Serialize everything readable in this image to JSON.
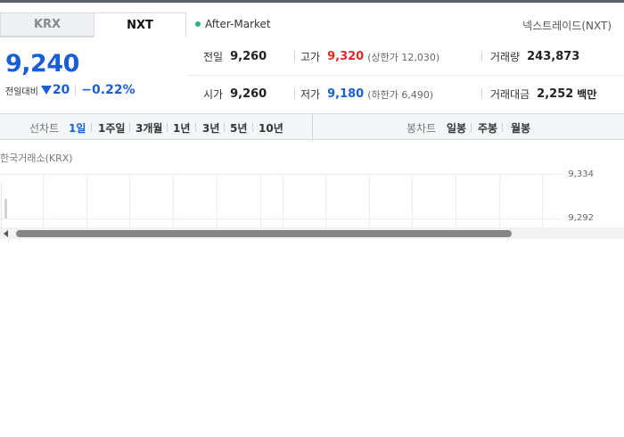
{
  "tabs": [
    {
      "label": "KRX",
      "selected": false
    },
    {
      "label": "NXT",
      "selected": true
    }
  ],
  "session": {
    "label": "After-Market",
    "dot_color": "#2ab27b"
  },
  "exchange_name": "넥스트레이드(NXT)",
  "price": {
    "current": "9,240",
    "change_label": "전일대비",
    "change_value": "20",
    "change_direction": "down",
    "change_percent": "−0.22%"
  },
  "stats": {
    "prev_close": {
      "label": "전일",
      "value": "9,260"
    },
    "high": {
      "label": "고가",
      "value": "9,320",
      "sub": "(상한가 12,030)"
    },
    "volume": {
      "label": "거래량",
      "value": "243,873"
    },
    "open": {
      "label": "시가",
      "value": "9,260"
    },
    "low": {
      "label": "저가",
      "value": "9,180",
      "sub": "(하한가 6,490)"
    },
    "amount": {
      "label": "거래대금",
      "value": "2,252",
      "unit": "백만"
    }
  },
  "line_chart": {
    "label": "선차트",
    "periods": [
      "1일",
      "1주일",
      "3개월",
      "1년",
      "3년",
      "5년",
      "10년"
    ],
    "active": "1일"
  },
  "candle_chart": {
    "label": "봉차트",
    "periods": [
      "일봉",
      "주봉",
      "월봉"
    ]
  },
  "chart_title": "한국거래소(KRX)",
  "y_ticks": [
    "9,334",
    "9,292"
  ],
  "colors": {
    "up": "#e02a2a",
    "down": "#1a5ed7",
    "accent": "#1a5ed7"
  }
}
